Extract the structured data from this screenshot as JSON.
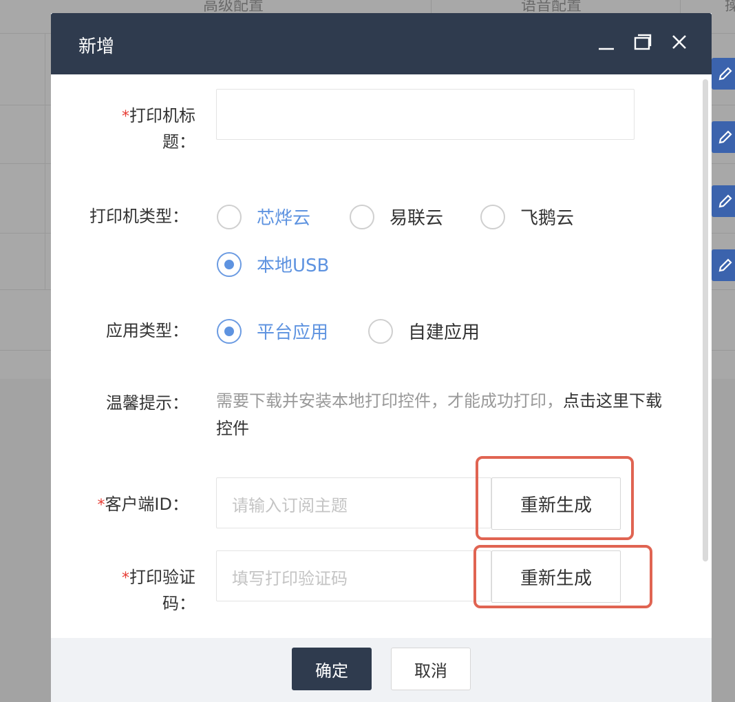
{
  "background": {
    "columns": [
      "高级配置",
      "语音配置",
      "操"
    ]
  },
  "modal": {
    "title": "新增",
    "fields": {
      "printer_title": {
        "required": "*",
        "label_line1": "打印机标",
        "label_line2": "题：",
        "value": ""
      },
      "printer_type": {
        "label": "打印机类型：",
        "options": [
          "芯烨云",
          "易联云",
          "飞鹅云",
          "本地USB"
        ],
        "selected": "本地USB"
      },
      "app_type": {
        "label": "应用类型：",
        "options": [
          "平台应用",
          "自建应用"
        ],
        "selected": "平台应用"
      },
      "tip": {
        "label": "温馨提示：",
        "text": "需要下载并安装本地打印控件，才能成功打印，",
        "link": "点击这里下载控件"
      },
      "client_id": {
        "required": "*",
        "label": "客户端ID：",
        "placeholder": "请输入订阅主题",
        "button": "重新生成"
      },
      "verify_code": {
        "required": "*",
        "label_line1": "打印验证",
        "label_line2": "码：",
        "placeholder": "填写打印验证码",
        "button": "重新生成"
      }
    },
    "footer": {
      "ok": "确定",
      "cancel": "取消"
    }
  },
  "colors": {
    "header": "#2f3b4e",
    "accent": "#5e93e0",
    "required": "#e63b33",
    "highlight": "#e06452"
  }
}
